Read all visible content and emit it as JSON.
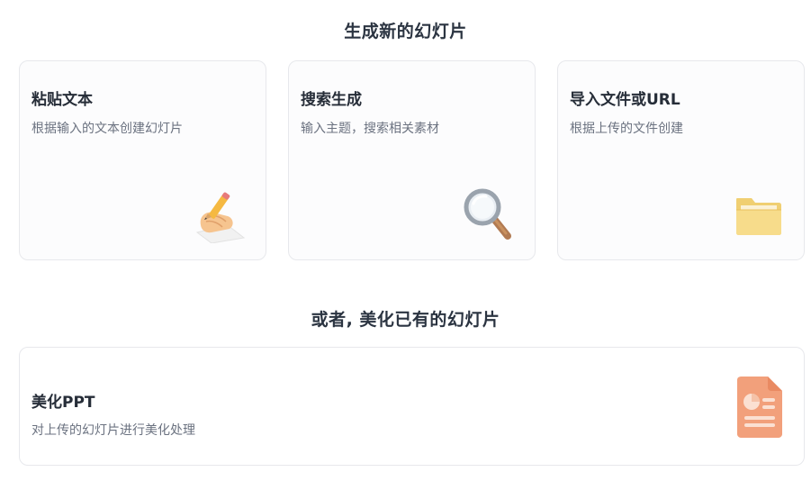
{
  "new_section": {
    "title": "生成新的幻灯片",
    "cards": [
      {
        "title": "粘贴文本",
        "description": "根据输入的文本创建幻灯片",
        "icon": "writing-hand-icon"
      },
      {
        "title": "搜索生成",
        "description": "输入主题，搜索相关素材",
        "icon": "magnifying-glass-icon"
      },
      {
        "title": "导入文件或URL",
        "description": "根据上传的文件创建",
        "icon": "folder-icon"
      }
    ]
  },
  "beautify_section": {
    "title": "或者, 美化已有的幻灯片",
    "card": {
      "title": "美化PPT",
      "description": "对上传的幻灯片进行美化处理",
      "icon": "presentation-file-icon"
    }
  },
  "colors": {
    "card_border": "#e7e8ec",
    "card_bg": "#fcfcfd",
    "title_text": "#2b3441",
    "desc_text": "#6b7280",
    "file_icon_accent": "#f2a07b"
  }
}
